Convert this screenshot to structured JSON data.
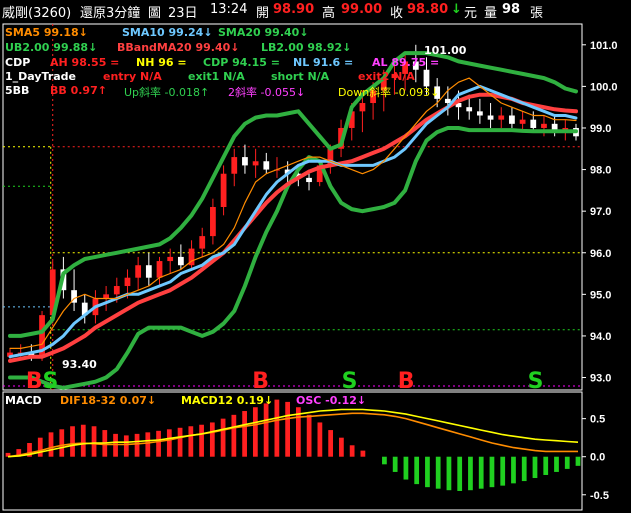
{
  "header": {
    "stock": "威剛(3260)",
    "period": "還原3分鐘",
    "day_icon": "圖",
    "date": "23日",
    "time": "13:24",
    "open_label": "開",
    "open": "98.90",
    "high_label": "高",
    "high": "99.00",
    "close_label": "收",
    "close": "98.80",
    "change_icon": "↓",
    "change_unit": "元",
    "volume_label": "量",
    "volume": "98",
    "volume_unit": "張"
  },
  "indicators": {
    "sma5": "SMA5 99.18↓",
    "sma10": "SMA10 99.24↓",
    "sma20": "SMA20 99.40↓",
    "ub2": "UB2.00 99.88↓",
    "bband": "BBandMA20 99.40↓",
    "lb2": "LB2.00 98.92↓",
    "cdp": "CDP",
    "ah": "AH 98.55 =",
    "nh": "NH 96 =",
    "cdpv": "CDP 94.15 =",
    "nl": "NL 91.6 =",
    "al": "AL 89.75 =",
    "daytrade": "1_DayTrade",
    "entry": "entry N/A",
    "exit1": "exit1 N/A",
    "short": "short N/A",
    "exit2": "exit2 N/A",
    "sbb": "5BB",
    "bb": "BB 0.97↑",
    "up": "Up斜率 -0.018↑",
    "two": "2斜率 -0.055↓",
    "down": "Down斜率 -0.093↓",
    "peak": "101.00",
    "low": "93.40"
  },
  "macd_legend": {
    "title": "MACD",
    "dif": "DIF18-32 0.07↓",
    "macd": "MACD12 0.19↓",
    "osc": "OSC -0.12↓"
  },
  "signals": [
    {
      "text": "B",
      "index": 3,
      "color": "#ff2020"
    },
    {
      "text": "S",
      "index": 5,
      "color": "#20d020"
    },
    {
      "text": "B",
      "index": 31,
      "color": "#ff2020"
    },
    {
      "text": "S",
      "index": 42,
      "color": "#20d020"
    },
    {
      "text": "B",
      "index": 49,
      "color": "#ff2020"
    },
    {
      "text": "S",
      "index": 65,
      "color": "#20d020"
    }
  ],
  "colors": {
    "up": "#ff2020",
    "down": "#ffffff",
    "sma5": "#ff8c00",
    "sma10": "#6ec8ff",
    "sma20": "#ff4040",
    "bands": "#30b040",
    "ah": "#ff2020",
    "nh": "#ffff00",
    "cdp": "#20d020",
    "nl": "#ffff00",
    "macd_line": "#ffff00",
    "dif_line": "#ff8c00",
    "osc_pos": "#ff2020",
    "osc_neg": "#20d020",
    "axis": "#ffffff",
    "grid": "#ff00ff"
  },
  "chart_data": [
    {
      "type": "candlestick",
      "title": "",
      "yaxis_ticks": [
        "101.0",
        "100.0",
        "99.0",
        "98.0",
        "97.0",
        "96.0",
        "95.0",
        "94.0",
        "93.0"
      ],
      "ylim": [
        92.7,
        101.5
      ],
      "reference_lines": {
        "AH": 98.55,
        "NH": 96,
        "CDP": 94.15,
        "prev_close": 98.55
      },
      "series": [
        {
          "name": "SMA5",
          "values": [
            93.7,
            93.7,
            93.75,
            93.8,
            94.2,
            94.6,
            94.9,
            95.0,
            94.9,
            94.9,
            94.9,
            95.0,
            95.1,
            95.2,
            95.4,
            95.5,
            95.6,
            95.8,
            95.9,
            96.0,
            96.2,
            96.6,
            97.2,
            97.7,
            97.9,
            98.0,
            98.1,
            98.2,
            98.3,
            98.3,
            98.2,
            98.1,
            98.0,
            97.9,
            98.0,
            98.2,
            98.5,
            98.8,
            99.1,
            99.4,
            99.6,
            99.9,
            100.1,
            100.2,
            100.0,
            99.8,
            99.6,
            99.5,
            99.4,
            99.3,
            99.3,
            99.2,
            99.2,
            99.18
          ]
        },
        {
          "name": "SMA10",
          "values": [
            93.5,
            93.55,
            93.6,
            93.65,
            93.8,
            94.0,
            94.3,
            94.5,
            94.7,
            94.8,
            94.9,
            95.0,
            95.0,
            95.1,
            95.2,
            95.3,
            95.5,
            95.6,
            95.7,
            95.9,
            96.0,
            96.2,
            96.6,
            97.0,
            97.4,
            97.7,
            97.9,
            98.1,
            98.2,
            98.2,
            98.2,
            98.1,
            98.1,
            98.1,
            98.1,
            98.2,
            98.3,
            98.5,
            98.8,
            99.1,
            99.3,
            99.5,
            99.8,
            99.9,
            100.0,
            99.9,
            99.8,
            99.7,
            99.6,
            99.5,
            99.4,
            99.3,
            99.3,
            99.24
          ]
        },
        {
          "name": "SMA20",
          "values": [
            93.4,
            93.45,
            93.5,
            93.5,
            93.6,
            93.7,
            93.85,
            94.0,
            94.2,
            94.35,
            94.5,
            94.65,
            94.8,
            94.9,
            95.0,
            95.1,
            95.25,
            95.4,
            95.6,
            95.8,
            96.0,
            96.3,
            96.6,
            96.9,
            97.2,
            97.45,
            97.65,
            97.8,
            97.95,
            98.05,
            98.1,
            98.15,
            98.2,
            98.3,
            98.4,
            98.5,
            98.65,
            98.8,
            99.0,
            99.2,
            99.35,
            99.5,
            99.65,
            99.75,
            99.8,
            99.8,
            99.75,
            99.7,
            99.6,
            99.55,
            99.5,
            99.45,
            99.42,
            99.4
          ]
        },
        {
          "name": "UB2.00",
          "values": [
            94.0,
            94.0,
            94.05,
            94.1,
            94.4,
            95.5,
            95.7,
            95.85,
            95.9,
            95.95,
            96.0,
            96.05,
            96.1,
            96.15,
            96.2,
            96.35,
            96.6,
            96.9,
            97.3,
            97.8,
            98.3,
            98.8,
            99.1,
            99.25,
            99.3,
            99.3,
            99.35,
            99.4,
            99.1,
            98.8,
            98.5,
            98.6,
            99.5,
            99.8,
            100.0,
            100.2,
            100.6,
            100.8,
            100.8,
            100.8,
            100.75,
            100.7,
            100.6,
            100.55,
            100.5,
            100.45,
            100.4,
            100.35,
            100.3,
            100.25,
            100.2,
            100.1,
            99.95,
            99.88
          ]
        },
        {
          "name": "LB2.00",
          "values": [
            93.0,
            93.0,
            93.0,
            92.9,
            92.8,
            92.75,
            92.8,
            92.85,
            92.9,
            93.0,
            93.2,
            93.6,
            94.05,
            94.2,
            94.2,
            94.2,
            94.2,
            94.1,
            94.0,
            94.1,
            94.3,
            94.6,
            95.2,
            95.9,
            96.5,
            97.0,
            97.6,
            98.0,
            98.3,
            98.2,
            97.6,
            97.2,
            97.05,
            97.0,
            97.05,
            97.1,
            97.2,
            97.5,
            98.2,
            98.7,
            98.9,
            99.0,
            99.0,
            98.95,
            98.95,
            98.95,
            98.95,
            98.95,
            98.93,
            98.92,
            98.92,
            98.92,
            98.92,
            98.92
          ]
        }
      ],
      "candles": [
        {
          "o": 93.5,
          "h": 93.7,
          "l": 93.4,
          "c": 93.6
        },
        {
          "o": 93.6,
          "h": 93.8,
          "l": 93.5,
          "c": 93.6
        },
        {
          "o": 93.6,
          "h": 93.8,
          "l": 93.4,
          "c": 93.5
        },
        {
          "o": 93.5,
          "h": 94.6,
          "l": 93.4,
          "c": 94.5
        },
        {
          "o": 94.5,
          "h": 95.8,
          "l": 94.3,
          "c": 95.6
        },
        {
          "o": 95.6,
          "h": 95.9,
          "l": 94.9,
          "c": 95.1
        },
        {
          "o": 95.1,
          "h": 95.6,
          "l": 94.6,
          "c": 94.8
        },
        {
          "o": 94.8,
          "h": 95.0,
          "l": 94.3,
          "c": 94.5
        },
        {
          "o": 94.5,
          "h": 95.1,
          "l": 94.3,
          "c": 94.9
        },
        {
          "o": 94.9,
          "h": 95.2,
          "l": 94.6,
          "c": 95.0
        },
        {
          "o": 95.0,
          "h": 95.4,
          "l": 94.8,
          "c": 95.2
        },
        {
          "o": 95.2,
          "h": 95.6,
          "l": 94.9,
          "c": 95.4
        },
        {
          "o": 95.4,
          "h": 95.9,
          "l": 95.1,
          "c": 95.7
        },
        {
          "o": 95.7,
          "h": 96.0,
          "l": 95.2,
          "c": 95.4
        },
        {
          "o": 95.4,
          "h": 95.9,
          "l": 95.2,
          "c": 95.8
        },
        {
          "o": 95.8,
          "h": 96.1,
          "l": 95.5,
          "c": 95.9
        },
        {
          "o": 95.9,
          "h": 96.2,
          "l": 95.6,
          "c": 95.7
        },
        {
          "o": 95.7,
          "h": 96.3,
          "l": 95.6,
          "c": 96.1
        },
        {
          "o": 96.1,
          "h": 96.6,
          "l": 95.9,
          "c": 96.4
        },
        {
          "o": 96.4,
          "h": 97.3,
          "l": 96.2,
          "c": 97.1
        },
        {
          "o": 97.1,
          "h": 98.1,
          "l": 96.9,
          "c": 97.9
        },
        {
          "o": 97.9,
          "h": 98.5,
          "l": 97.6,
          "c": 98.3
        },
        {
          "o": 98.3,
          "h": 98.6,
          "l": 97.9,
          "c": 98.1
        },
        {
          "o": 98.1,
          "h": 98.5,
          "l": 97.8,
          "c": 98.2
        },
        {
          "o": 98.2,
          "h": 98.4,
          "l": 97.9,
          "c": 98.0
        },
        {
          "o": 98.0,
          "h": 98.3,
          "l": 97.8,
          "c": 98.0
        },
        {
          "o": 98.0,
          "h": 98.2,
          "l": 97.7,
          "c": 97.9
        },
        {
          "o": 97.9,
          "h": 98.1,
          "l": 97.6,
          "c": 97.8
        },
        {
          "o": 97.8,
          "h": 98.0,
          "l": 97.5,
          "c": 97.7
        },
        {
          "o": 97.7,
          "h": 98.2,
          "l": 97.6,
          "c": 98.1
        },
        {
          "o": 98.1,
          "h": 98.6,
          "l": 97.9,
          "c": 98.5
        },
        {
          "o": 98.5,
          "h": 99.2,
          "l": 98.3,
          "c": 99.0
        },
        {
          "o": 99.0,
          "h": 99.6,
          "l": 98.7,
          "c": 99.4
        },
        {
          "o": 99.4,
          "h": 99.9,
          "l": 98.9,
          "c": 99.6
        },
        {
          "o": 99.6,
          "h": 100.1,
          "l": 99.2,
          "c": 99.9
        },
        {
          "o": 99.9,
          "h": 100.4,
          "l": 99.4,
          "c": 100.2
        },
        {
          "o": 100.2,
          "h": 100.6,
          "l": 99.8,
          "c": 100.3
        },
        {
          "o": 100.3,
          "h": 100.8,
          "l": 99.9,
          "c": 100.6
        },
        {
          "o": 100.6,
          "h": 101.0,
          "l": 100.1,
          "c": 100.4
        },
        {
          "o": 100.4,
          "h": 100.7,
          "l": 99.8,
          "c": 100.0
        },
        {
          "o": 100.0,
          "h": 100.2,
          "l": 99.5,
          "c": 99.7
        },
        {
          "o": 99.7,
          "h": 100.0,
          "l": 99.3,
          "c": 99.6
        },
        {
          "o": 99.6,
          "h": 99.9,
          "l": 99.2,
          "c": 99.5
        },
        {
          "o": 99.5,
          "h": 99.8,
          "l": 99.2,
          "c": 99.4
        },
        {
          "o": 99.4,
          "h": 99.7,
          "l": 99.1,
          "c": 99.3
        },
        {
          "o": 99.3,
          "h": 99.6,
          "l": 99.0,
          "c": 99.2
        },
        {
          "o": 99.2,
          "h": 99.5,
          "l": 99.0,
          "c": 99.3
        },
        {
          "o": 99.3,
          "h": 99.5,
          "l": 99.0,
          "c": 99.1
        },
        {
          "o": 99.1,
          "h": 99.4,
          "l": 98.9,
          "c": 99.2
        },
        {
          "o": 99.2,
          "h": 99.4,
          "l": 98.9,
          "c": 99.0
        },
        {
          "o": 99.0,
          "h": 99.3,
          "l": 98.8,
          "c": 99.1
        },
        {
          "o": 99.1,
          "h": 99.3,
          "l": 98.8,
          "c": 98.9
        },
        {
          "o": 98.9,
          "h": 99.2,
          "l": 98.7,
          "c": 99.0
        },
        {
          "o": 99.0,
          "h": 99.1,
          "l": 98.7,
          "c": 98.8
        }
      ]
    },
    {
      "type": "line+bar",
      "title": "MACD",
      "yaxis_ticks": [
        "0.5",
        "0.0",
        "-0.5"
      ],
      "ylim": [
        -0.7,
        0.85
      ],
      "series": [
        {
          "name": "DIF18-32",
          "values": [
            0.0,
            0.02,
            0.05,
            0.08,
            0.12,
            0.15,
            0.17,
            0.18,
            0.17,
            0.16,
            0.16,
            0.16,
            0.17,
            0.18,
            0.2,
            0.22,
            0.25,
            0.28,
            0.3,
            0.32,
            0.35,
            0.38,
            0.4,
            0.42,
            0.45,
            0.48,
            0.5,
            0.52,
            0.53,
            0.54,
            0.55,
            0.56,
            0.57,
            0.57,
            0.56,
            0.55,
            0.53,
            0.5,
            0.46,
            0.42,
            0.38,
            0.34,
            0.3,
            0.26,
            0.22,
            0.18,
            0.15,
            0.12,
            0.1,
            0.08,
            0.07,
            0.07,
            0.07,
            0.07
          ]
        },
        {
          "name": "MACD12",
          "values": [
            0.0,
            0.01,
            0.03,
            0.06,
            0.09,
            0.12,
            0.15,
            0.17,
            0.18,
            0.18,
            0.19,
            0.19,
            0.2,
            0.21,
            0.22,
            0.24,
            0.26,
            0.28,
            0.3,
            0.33,
            0.36,
            0.39,
            0.42,
            0.45,
            0.48,
            0.51,
            0.54,
            0.56,
            0.58,
            0.6,
            0.61,
            0.62,
            0.62,
            0.62,
            0.61,
            0.6,
            0.58,
            0.56,
            0.53,
            0.5,
            0.47,
            0.44,
            0.41,
            0.38,
            0.35,
            0.32,
            0.29,
            0.27,
            0.25,
            0.23,
            0.22,
            0.21,
            0.2,
            0.19
          ]
        },
        {
          "name": "OSC",
          "values": [
            0.05,
            0.1,
            0.18,
            0.25,
            0.32,
            0.36,
            0.4,
            0.42,
            0.4,
            0.35,
            0.3,
            0.28,
            0.3,
            0.32,
            0.34,
            0.36,
            0.38,
            0.4,
            0.42,
            0.45,
            0.5,
            0.55,
            0.6,
            0.65,
            0.7,
            0.75,
            0.72,
            0.65,
            0.55,
            0.45,
            0.35,
            0.25,
            0.15,
            0.08,
            0.0,
            -0.1,
            -0.2,
            -0.3,
            -0.36,
            -0.4,
            -0.42,
            -0.44,
            -0.45,
            -0.44,
            -0.42,
            -0.4,
            -0.38,
            -0.35,
            -0.32,
            -0.28,
            -0.24,
            -0.2,
            -0.16,
            -0.12
          ]
        }
      ]
    }
  ]
}
